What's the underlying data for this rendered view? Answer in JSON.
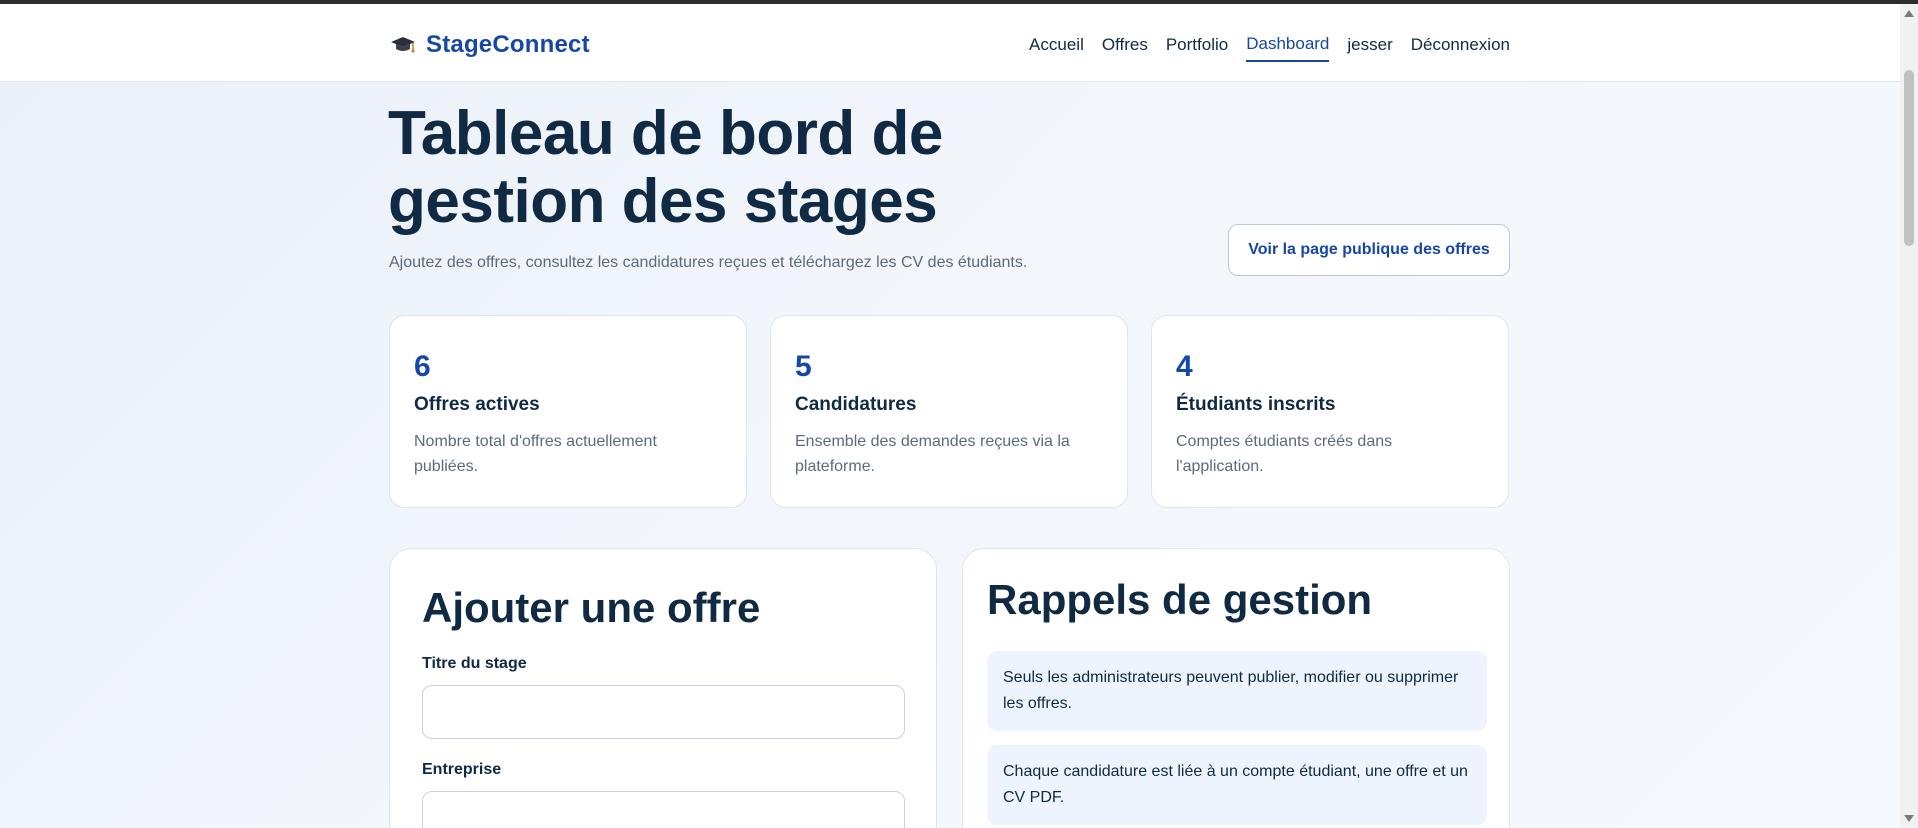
{
  "app": {
    "brand": "StageConnect",
    "brand_icon": "graduation-cap-icon"
  },
  "nav": {
    "items": [
      {
        "label": "Accueil",
        "active": false
      },
      {
        "label": "Offres",
        "active": false
      },
      {
        "label": "Portfolio",
        "active": false
      },
      {
        "label": "Dashboard",
        "active": true
      },
      {
        "label": "jesser",
        "active": false
      },
      {
        "label": "Déconnexion",
        "active": false
      }
    ]
  },
  "hero": {
    "title": "Tableau de bord de gestion des stages",
    "subtitle": "Ajoutez des offres, consultez les candidatures reçues et téléchargez les CV des étudiants.",
    "public_button": "Voir la page publique des offres"
  },
  "stats": [
    {
      "value": "6",
      "label": "Offres actives",
      "desc": "Nombre total d'offres actuellement publiées."
    },
    {
      "value": "5",
      "label": "Candidatures",
      "desc": "Ensemble des demandes reçues via la plateforme."
    },
    {
      "value": "4",
      "label": "Étudiants inscrits",
      "desc": "Comptes étudiants créés dans l'application."
    }
  ],
  "add_offer": {
    "title": "Ajouter une offre",
    "fields": [
      {
        "label": "Titre du stage",
        "value": ""
      },
      {
        "label": "Entreprise",
        "value": ""
      }
    ]
  },
  "reminders": {
    "title": "Rappels de gestion",
    "items": [
      "Seuls les administrateurs peuvent publier, modifier ou supprimer les offres.",
      "Chaque candidature est liée à un compte étudiant, une offre et un CV PDF."
    ]
  },
  "colors": {
    "accent": "#1747a6",
    "heading": "#102a43",
    "muted": "#5b6b7d",
    "reminder_bg": "#eef4fd"
  }
}
